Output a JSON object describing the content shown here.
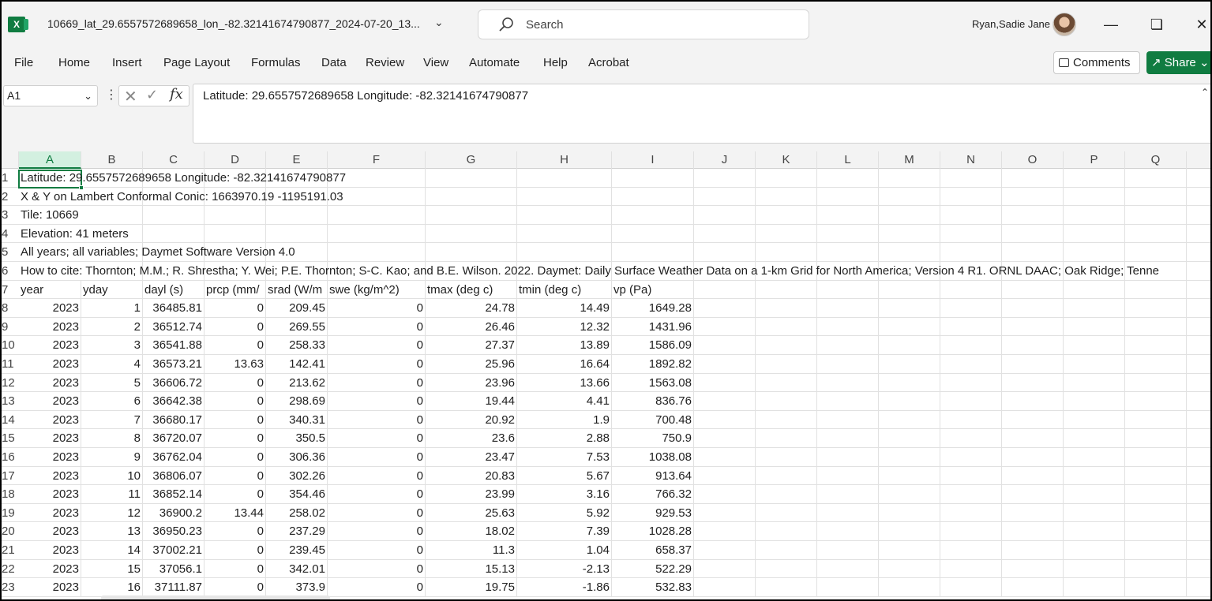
{
  "window": {
    "app_icon": "excel-icon",
    "filename": "10669_lat_29.6557572689658_lon_-82.32141674790877_2024-07-20_13...",
    "search_placeholder": "Search",
    "user_name": "Ryan,Sadie Jane",
    "accent": "#107c41"
  },
  "menu": {
    "items": [
      "File",
      "Home",
      "Insert",
      "Page Layout",
      "Formulas",
      "Data",
      "Review",
      "View",
      "Automate",
      "Help",
      "Acrobat"
    ],
    "comments_label": "Comments",
    "share_label": "Share"
  },
  "formula_bar": {
    "name_box": "A1",
    "fx_label": "fx",
    "content": "Latitude: 29.6557572689658  Longitude: -82.32141674790877"
  },
  "grid": {
    "columns": [
      "A",
      "B",
      "C",
      "D",
      "E",
      "F",
      "G",
      "H",
      "I",
      "J",
      "K",
      "L",
      "M",
      "N",
      "O",
      "P",
      "Q"
    ],
    "selected_column": "A",
    "header_rows": [
      {
        "row": "1",
        "text": "Latitude: 29.6557572689658  Longitude: -82.32141674790877"
      },
      {
        "row": "2",
        "text": "X & Y on Lambert Conformal Conic: 1663970.19 -1195191.03"
      },
      {
        "row": "3",
        "text": "Tile: 10669"
      },
      {
        "row": "4",
        "text": "Elevation: 41 meters"
      },
      {
        "row": "5",
        "text": "All years; all variables; Daymet Software Version 4.0"
      },
      {
        "row": "6",
        "text": "How to cite: Thornton; M.M.; R. Shrestha; Y. Wei; P.E. Thornton; S-C. Kao; and B.E. Wilson. 2022. Daymet: Daily Surface Weather Data on a 1-km Grid for North America; Version 4 R1. ORNL DAAC; Oak Ridge; Tenne"
      }
    ],
    "column_header_row": {
      "row": "7",
      "labels": [
        "year",
        "yday",
        "dayl (s)",
        "prcp (mm/",
        "srad (W/m",
        "swe (kg/m^2)",
        "tmax (deg c)",
        "tmin (deg c)",
        "vp (Pa)"
      ]
    },
    "data_rows": [
      {
        "row": "8",
        "cells": [
          "2023",
          "1",
          "36485.81",
          "0",
          "209.45",
          "0",
          "24.78",
          "14.49",
          "1649.28"
        ]
      },
      {
        "row": "9",
        "cells": [
          "2023",
          "2",
          "36512.74",
          "0",
          "269.55",
          "0",
          "26.46",
          "12.32",
          "1431.96"
        ]
      },
      {
        "row": "10",
        "cells": [
          "2023",
          "3",
          "36541.88",
          "0",
          "258.33",
          "0",
          "27.37",
          "13.89",
          "1586.09"
        ]
      },
      {
        "row": "11",
        "cells": [
          "2023",
          "4",
          "36573.21",
          "13.63",
          "142.41",
          "0",
          "25.96",
          "16.64",
          "1892.82"
        ]
      },
      {
        "row": "12",
        "cells": [
          "2023",
          "5",
          "36606.72",
          "0",
          "213.62",
          "0",
          "23.96",
          "13.66",
          "1563.08"
        ]
      },
      {
        "row": "13",
        "cells": [
          "2023",
          "6",
          "36642.38",
          "0",
          "298.69",
          "0",
          "19.44",
          "4.41",
          "836.76"
        ]
      },
      {
        "row": "14",
        "cells": [
          "2023",
          "7",
          "36680.17",
          "0",
          "340.31",
          "0",
          "20.92",
          "1.9",
          "700.48"
        ]
      },
      {
        "row": "15",
        "cells": [
          "2023",
          "8",
          "36720.07",
          "0",
          "350.5",
          "0",
          "23.6",
          "2.88",
          "750.9"
        ]
      },
      {
        "row": "16",
        "cells": [
          "2023",
          "9",
          "36762.04",
          "0",
          "306.36",
          "0",
          "23.47",
          "7.53",
          "1038.08"
        ]
      },
      {
        "row": "17",
        "cells": [
          "2023",
          "10",
          "36806.07",
          "0",
          "302.26",
          "0",
          "20.83",
          "5.67",
          "913.64"
        ]
      },
      {
        "row": "18",
        "cells": [
          "2023",
          "11",
          "36852.14",
          "0",
          "354.46",
          "0",
          "23.99",
          "3.16",
          "766.32"
        ]
      },
      {
        "row": "19",
        "cells": [
          "2023",
          "12",
          "36900.2",
          "13.44",
          "258.02",
          "0",
          "25.63",
          "5.92",
          "929.53"
        ]
      },
      {
        "row": "20",
        "cells": [
          "2023",
          "13",
          "36950.23",
          "0",
          "237.29",
          "0",
          "18.02",
          "7.39",
          "1028.28"
        ]
      },
      {
        "row": "21",
        "cells": [
          "2023",
          "14",
          "37002.21",
          "0",
          "239.45",
          "0",
          "11.3",
          "1.04",
          "658.37"
        ]
      },
      {
        "row": "22",
        "cells": [
          "2023",
          "15",
          "37056.1",
          "0",
          "342.01",
          "0",
          "15.13",
          "-2.13",
          "522.29"
        ]
      },
      {
        "row": "23",
        "cells": [
          "2023",
          "16",
          "37111.87",
          "0",
          "373.9",
          "0",
          "19.75",
          "-1.86",
          "532.83"
        ]
      }
    ]
  }
}
